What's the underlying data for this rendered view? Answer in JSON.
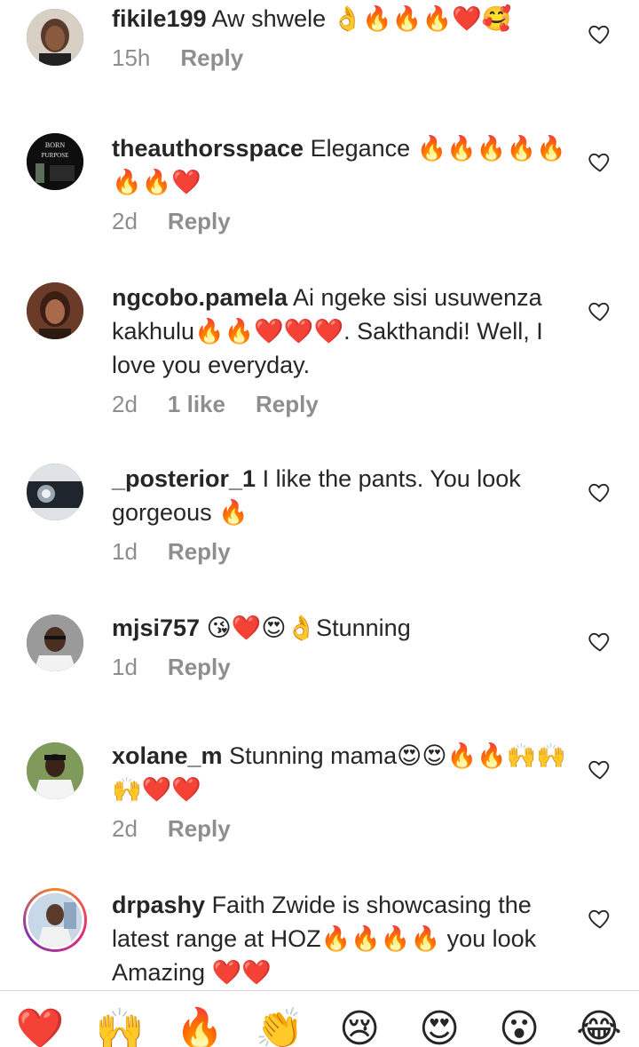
{
  "comments": [
    {
      "username": "fikile199",
      "text": "Aw shwele 👌🔥🔥🔥❤️🥰",
      "time": "15h",
      "likes": "",
      "reply": "Reply",
      "avatar_icon": "woman-portrait-avatar",
      "avatar_color": "#3a2a22"
    },
    {
      "username": "theauthorsspace",
      "text": "Elegance 🔥🔥🔥🔥🔥🔥🔥❤️",
      "time": "2d",
      "likes": "",
      "reply": "Reply",
      "avatar_icon": "born-for-purpose-logo-avatar",
      "avatar_color": "#111111",
      "avatar_text": [
        "BORN",
        "PURPOSE"
      ]
    },
    {
      "username": "ngcobo.pamela",
      "text": "Ai ngeke sisi usuwenza kakhulu🔥🔥❤️❤️❤️. Sakthandi! Well, I love you everyday.",
      "time": "2d",
      "likes": "1 like",
      "reply": "Reply",
      "avatar_icon": "woman-portrait-avatar",
      "avatar_color": "#6b3b2a"
    },
    {
      "username": "_posterior_1",
      "text": "I like the pants. You look gorgeous 🔥",
      "time": "1d",
      "likes": "",
      "reply": "Reply",
      "avatar_icon": "car-headlight-avatar",
      "avatar_color": "#2f3a44"
    },
    {
      "username": "mjsi757",
      "text": "😘❤️😍👌Stunning",
      "time": "1d",
      "likes": "",
      "reply": "Reply",
      "avatar_icon": "man-portrait-avatar",
      "avatar_color": "#4a4a4a"
    },
    {
      "username": "xolane_m",
      "text": "Stunning mama😍😍🔥🔥🙌🙌🙌❤️❤️",
      "time": "2d",
      "likes": "",
      "reply": "Reply",
      "avatar_icon": "man-portrait-avatar",
      "avatar_color": "#5c7a3a"
    },
    {
      "username": "drpashy",
      "text": "Faith Zwide is showcasing the latest range at HOZ🔥🔥🔥🔥 you look Amazing ❤️❤️",
      "time": "",
      "likes": "",
      "reply": "",
      "avatar_icon": "woman-portrait-avatar",
      "avatar_color": "#8fa6c0",
      "has_story": true
    }
  ],
  "quick_reactions": [
    {
      "emoji": "❤️",
      "icon": "red-heart-icon"
    },
    {
      "emoji": "🙌",
      "icon": "raising-hands-icon"
    },
    {
      "emoji": "🔥",
      "icon": "fire-icon"
    },
    {
      "emoji": "👏",
      "icon": "clapping-hands-icon"
    },
    {
      "emoji": "😢",
      "icon": "crying-face-icon"
    },
    {
      "emoji": "😍",
      "icon": "heart-eyes-icon"
    },
    {
      "emoji": "😮",
      "icon": "surprised-face-icon"
    },
    {
      "emoji": "😂",
      "icon": "tears-of-joy-icon"
    }
  ]
}
